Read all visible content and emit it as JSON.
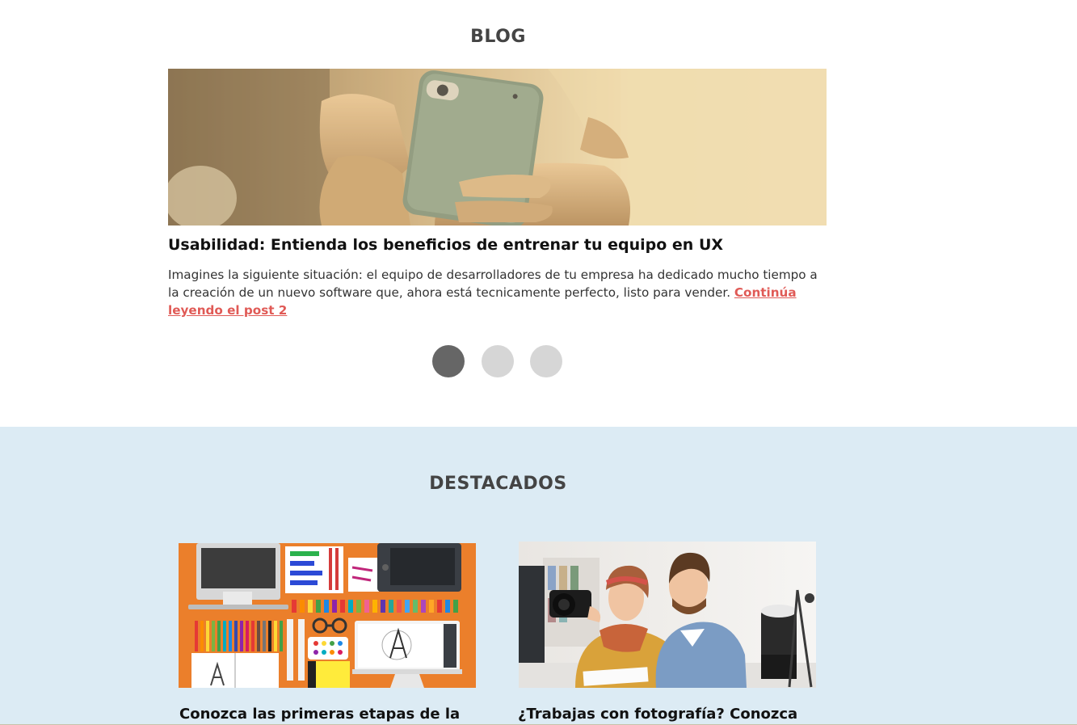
{
  "blog": {
    "title": "BLOG",
    "post": {
      "title": "Usabilidad: Entienda los beneficios de entrenar tu equipo en UX",
      "excerpt": "Imagines la siguiente situación: el equipo de desarrolladores de tu empresa ha dedicado mucho tiempo a la creación de un nuevo software que, ahora está tecnicamente perfecto, listo para vender. ",
      "read_more": "Continúa leyendo el post 2"
    },
    "carousel": {
      "active_index": 0,
      "count": 3
    }
  },
  "featured": {
    "title": "DESTACADOS",
    "cards": [
      {
        "title": "Conozca las primeras etapas de la"
      },
      {
        "title": "¿Trabajas con fotografía? Conozca"
      }
    ]
  },
  "colors": {
    "accent_link": "#e05a56",
    "featured_bg": "#dcebf4",
    "dot_active": "#666666",
    "dot_inactive": "#d6d6d6"
  }
}
